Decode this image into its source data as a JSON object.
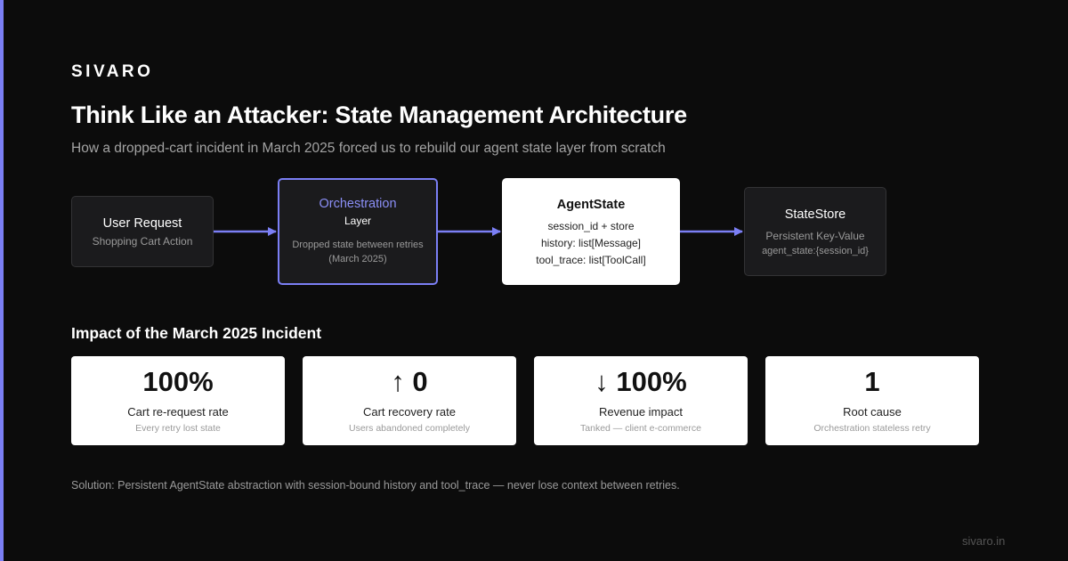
{
  "brand": "SIVARO",
  "title": "Think Like an Attacker: State Management Architecture",
  "subtitle": "How a dropped-cart incident in March 2025 forced us to rebuild our agent state layer from scratch",
  "colors": {
    "accent": "#7b7ff5",
    "background": "#0c0c0c",
    "card": "#ffffff",
    "muted": "#9a9a9a"
  },
  "flow": {
    "user_request": {
      "title": "User Request",
      "subtitle": "Shopping Cart Action"
    },
    "orchestration": {
      "title": "Orchestration",
      "layer": "Layer",
      "note": "Dropped state between retries (March 2025)"
    },
    "agent_state": {
      "title": "AgentState",
      "lines": [
        "session_id + store",
        "history: list[Message]",
        "tool_trace: list[ToolCall]"
      ]
    },
    "state_store": {
      "title": "StateStore",
      "subtitle": "Persistent Key-Value",
      "key": "agent_state:{session_id}"
    }
  },
  "impact": {
    "heading": "Impact of the March 2025 Incident",
    "cards": [
      {
        "value": "100%",
        "label": "Cart re-request rate",
        "note": "Every retry lost state"
      },
      {
        "value": "↑ 0",
        "label": "Cart recovery rate",
        "note": "Users abandoned completely"
      },
      {
        "value": "↓ 100%",
        "label": "Revenue impact",
        "note": "Tanked — client e-commerce"
      },
      {
        "value": "1",
        "label": "Root cause",
        "note": "Orchestration stateless retry"
      }
    ]
  },
  "solution": "Solution: Persistent AgentState abstraction with session-bound history and tool_trace — never lose context between retries.",
  "footer": "sivaro.in"
}
